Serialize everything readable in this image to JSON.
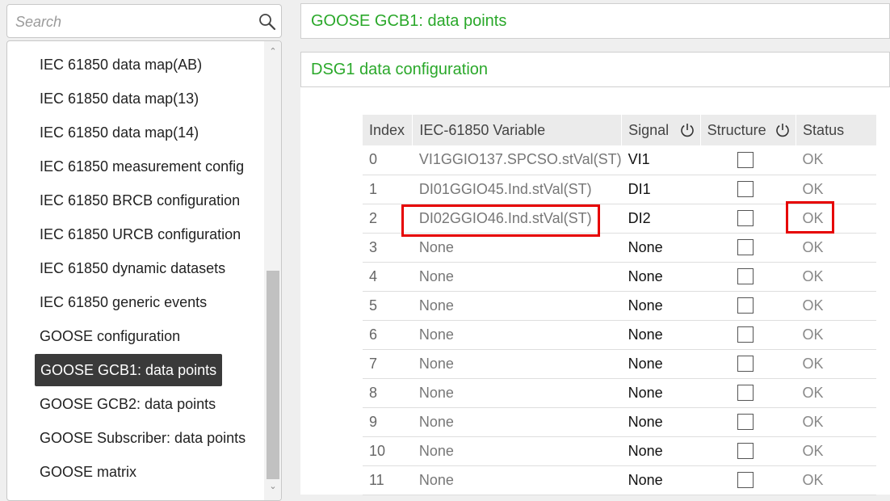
{
  "search": {
    "placeholder": "Search"
  },
  "nav": {
    "items": [
      {
        "label": "IEC 61850 data map(AB)"
      },
      {
        "label": "IEC 61850 data map(13)"
      },
      {
        "label": "IEC 61850 data map(14)"
      },
      {
        "label": "IEC 61850 measurement config"
      },
      {
        "label": "IEC 61850 BRCB configuration"
      },
      {
        "label": "IEC 61850 URCB configuration"
      },
      {
        "label": "IEC 61850 dynamic datasets"
      },
      {
        "label": "IEC 61850 generic events"
      },
      {
        "label": "GOOSE configuration"
      },
      {
        "label": "GOOSE GCB1: data points",
        "active": true
      },
      {
        "label": "GOOSE GCB2: data points"
      },
      {
        "label": "GOOSE Subscriber: data points"
      },
      {
        "label": "GOOSE matrix"
      }
    ]
  },
  "sections": {
    "goose_title": "GOOSE GCB1: data points",
    "dsg_title": "DSG1 data configuration"
  },
  "table": {
    "headers": [
      "Index",
      "IEC-61850 Variable",
      "Signal",
      "Structure",
      "Status"
    ],
    "rows": [
      {
        "index": "0",
        "variable": "VI1GGIO137.SPCSO.stVal(ST)",
        "signal": "VI1",
        "structure": false,
        "status": "OK"
      },
      {
        "index": "1",
        "variable": "DI01GGIO45.Ind.stVal(ST)",
        "signal": "DI1",
        "structure": false,
        "status": "OK"
      },
      {
        "index": "2",
        "variable": "DI02GGIO46.Ind.stVal(ST)",
        "signal": "DI2",
        "structure": false,
        "status": "OK"
      },
      {
        "index": "3",
        "variable": "None",
        "signal": "None",
        "structure": false,
        "status": "OK"
      },
      {
        "index": "4",
        "variable": "None",
        "signal": "None",
        "structure": false,
        "status": "OK"
      },
      {
        "index": "5",
        "variable": "None",
        "signal": "None",
        "structure": false,
        "status": "OK"
      },
      {
        "index": "6",
        "variable": "None",
        "signal": "None",
        "structure": false,
        "status": "OK"
      },
      {
        "index": "7",
        "variable": "None",
        "signal": "None",
        "structure": false,
        "status": "OK"
      },
      {
        "index": "8",
        "variable": "None",
        "signal": "None",
        "structure": false,
        "status": "OK"
      },
      {
        "index": "9",
        "variable": "None",
        "signal": "None",
        "structure": false,
        "status": "OK"
      },
      {
        "index": "10",
        "variable": "None",
        "signal": "None",
        "structure": false,
        "status": "OK"
      },
      {
        "index": "11",
        "variable": "None",
        "signal": "None",
        "structure": false,
        "status": "OK"
      }
    ]
  },
  "icons": {
    "search": "search-icon",
    "signal_header": "power-icon",
    "structure_header": "power-icon"
  },
  "colors": {
    "accent_green": "#2aa82a",
    "active_nav_bg": "#3a3a3a",
    "highlight_red": "#e60000"
  }
}
